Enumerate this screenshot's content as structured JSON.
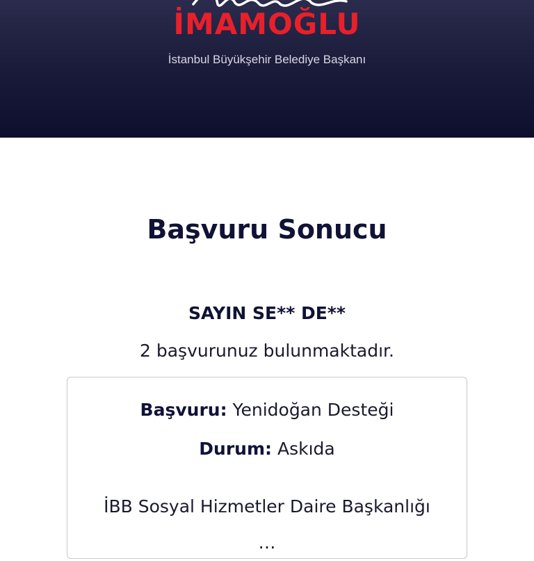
{
  "header": {
    "brand_name": "İMAMOĞLU",
    "subtitle": "İstanbul Büyükşehir Belediye Başkanı",
    "brand_color": "#e8202a",
    "background_color": "#12123a"
  },
  "main": {
    "title": "Başvuru Sonucu",
    "greeting": "SAYIN SE** DE**",
    "count_text": "2 başvurunuz bulunmaktadır."
  },
  "card": {
    "application_label": "Başvuru:",
    "application_value": "Yenidoğan Desteği",
    "status_label": "Durum:",
    "status_value": "Askıda",
    "note": "İBB Sosyal Hizmetler Daire Başkanlığı …"
  }
}
